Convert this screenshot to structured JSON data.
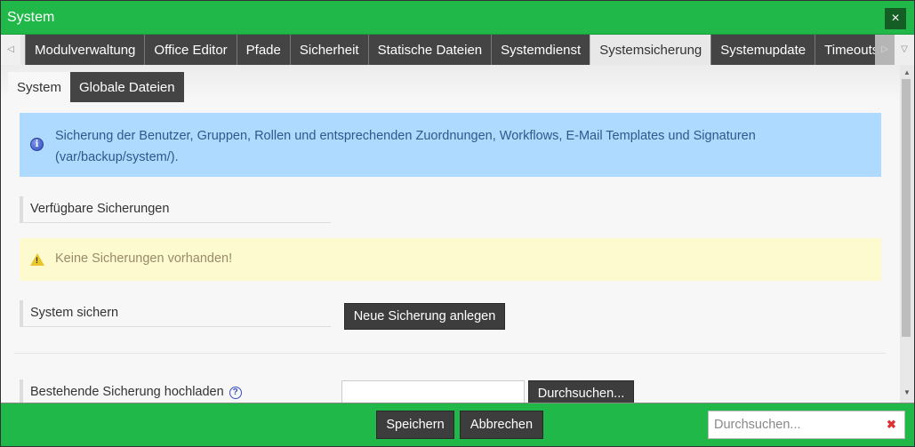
{
  "window": {
    "title": "System",
    "close_icon": "×"
  },
  "tabbar": {
    "scroll_left_icon": "◁",
    "scroll_right_icon": "▷",
    "menu_icon": "▽",
    "tabs": [
      {
        "label": "Modulverwaltung",
        "active": false
      },
      {
        "label": "Office Editor",
        "active": false
      },
      {
        "label": "Pfade",
        "active": false
      },
      {
        "label": "Sicherheit",
        "active": false
      },
      {
        "label": "Statische Dateien",
        "active": false
      },
      {
        "label": "Systemdienst",
        "active": false
      },
      {
        "label": "Systemsicherung",
        "active": true
      },
      {
        "label": "Systemupdate",
        "active": false
      },
      {
        "label": "Timeouts",
        "active": false
      }
    ]
  },
  "subtabs": [
    {
      "label": "System",
      "active": true
    },
    {
      "label": "Globale Dateien",
      "active": false
    }
  ],
  "info": {
    "icon": "i",
    "text_line1": "Sicherung der Benutzer, Gruppen, Rollen und entsprechenden Zuordnungen, Workflows, E-Mail Templates und Signaturen",
    "text_line2": "(var/backup/system/)."
  },
  "available_backups": {
    "label": "Verfügbare Sicherungen",
    "warning_icon": "!",
    "warning_text": "Keine Sicherungen vorhanden!"
  },
  "backup_system": {
    "label": "System sichern",
    "button_label": "Neue Sicherung anlegen"
  },
  "upload": {
    "label": "Bestehende Sicherung hochladen",
    "help_icon": "?",
    "file_value": "",
    "browse_label": "Durchsuchen..."
  },
  "scrollbar": {
    "up_icon": "▲",
    "down_icon": "▼"
  },
  "footer": {
    "save_label": "Speichern",
    "cancel_label": "Abbrechen",
    "search_placeholder": "Durchsuchen...",
    "search_value": "",
    "clear_icon": "✖"
  },
  "colors": {
    "titlebar": "#21b84a",
    "close_button": "#145e25",
    "tab_dark": "#444444",
    "info_bg": "#aedaff",
    "warning_bg": "#fefad0"
  }
}
